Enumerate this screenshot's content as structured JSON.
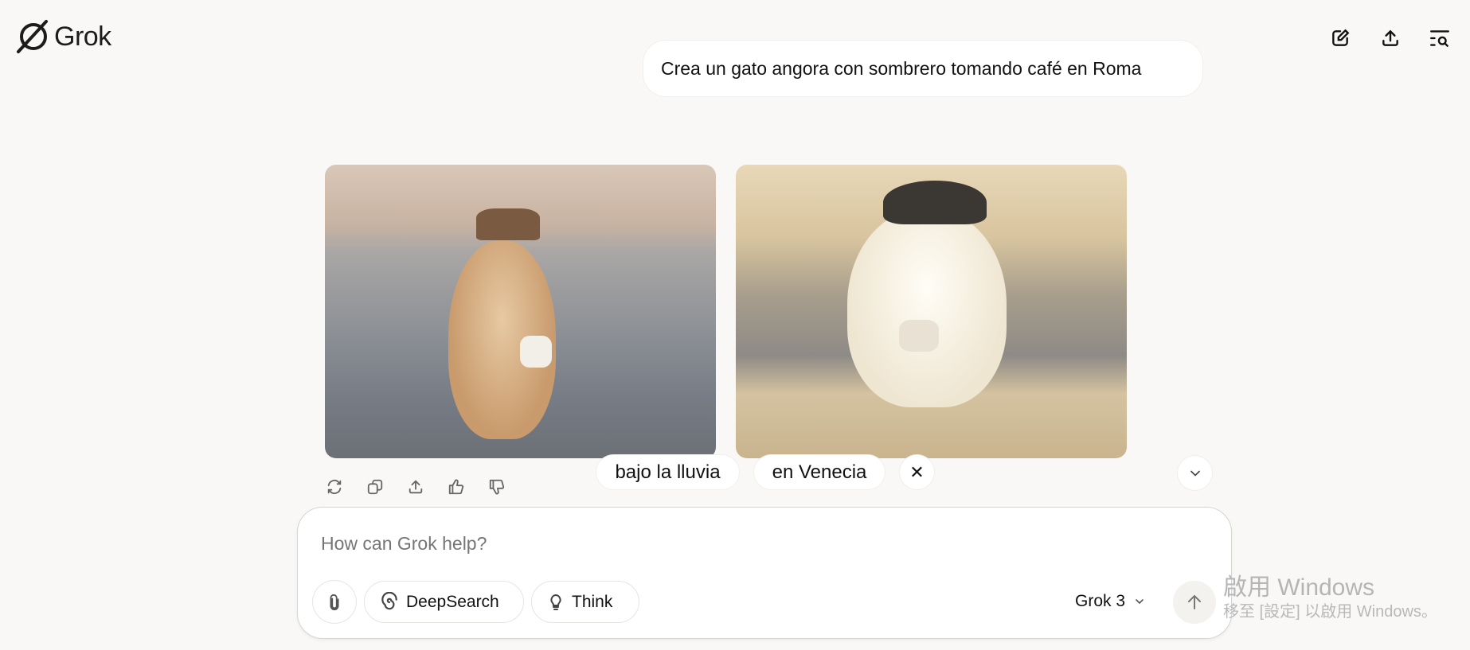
{
  "header": {
    "logo_text": "Grok",
    "icons": [
      "new-chat-icon",
      "share-icon",
      "history-search-icon"
    ]
  },
  "conversation": {
    "user_message": "Crea un gato angora con sombrero tomando café en Roma",
    "images": [
      "orange-angora-cat-with-fedora-holding-coffee-cup",
      "white-angora-cat-with-beret-holding-coffee-cup"
    ],
    "actions": [
      "regenerate-icon",
      "copy-icon",
      "share-icon",
      "thumbs-up-icon",
      "thumbs-down-icon"
    ]
  },
  "suggestions": {
    "items": [
      "bajo la lluvia",
      "en Venecia"
    ],
    "close": "✕",
    "scroll_down": "⌄"
  },
  "composer": {
    "placeholder": "How can Grok help?",
    "deepsearch_label": "DeepSearch",
    "think_label": "Think",
    "model_label": "Grok 3"
  },
  "watermark": {
    "line1": "啟用 Windows",
    "line2": "移至 [設定] 以啟用 Windows。"
  }
}
